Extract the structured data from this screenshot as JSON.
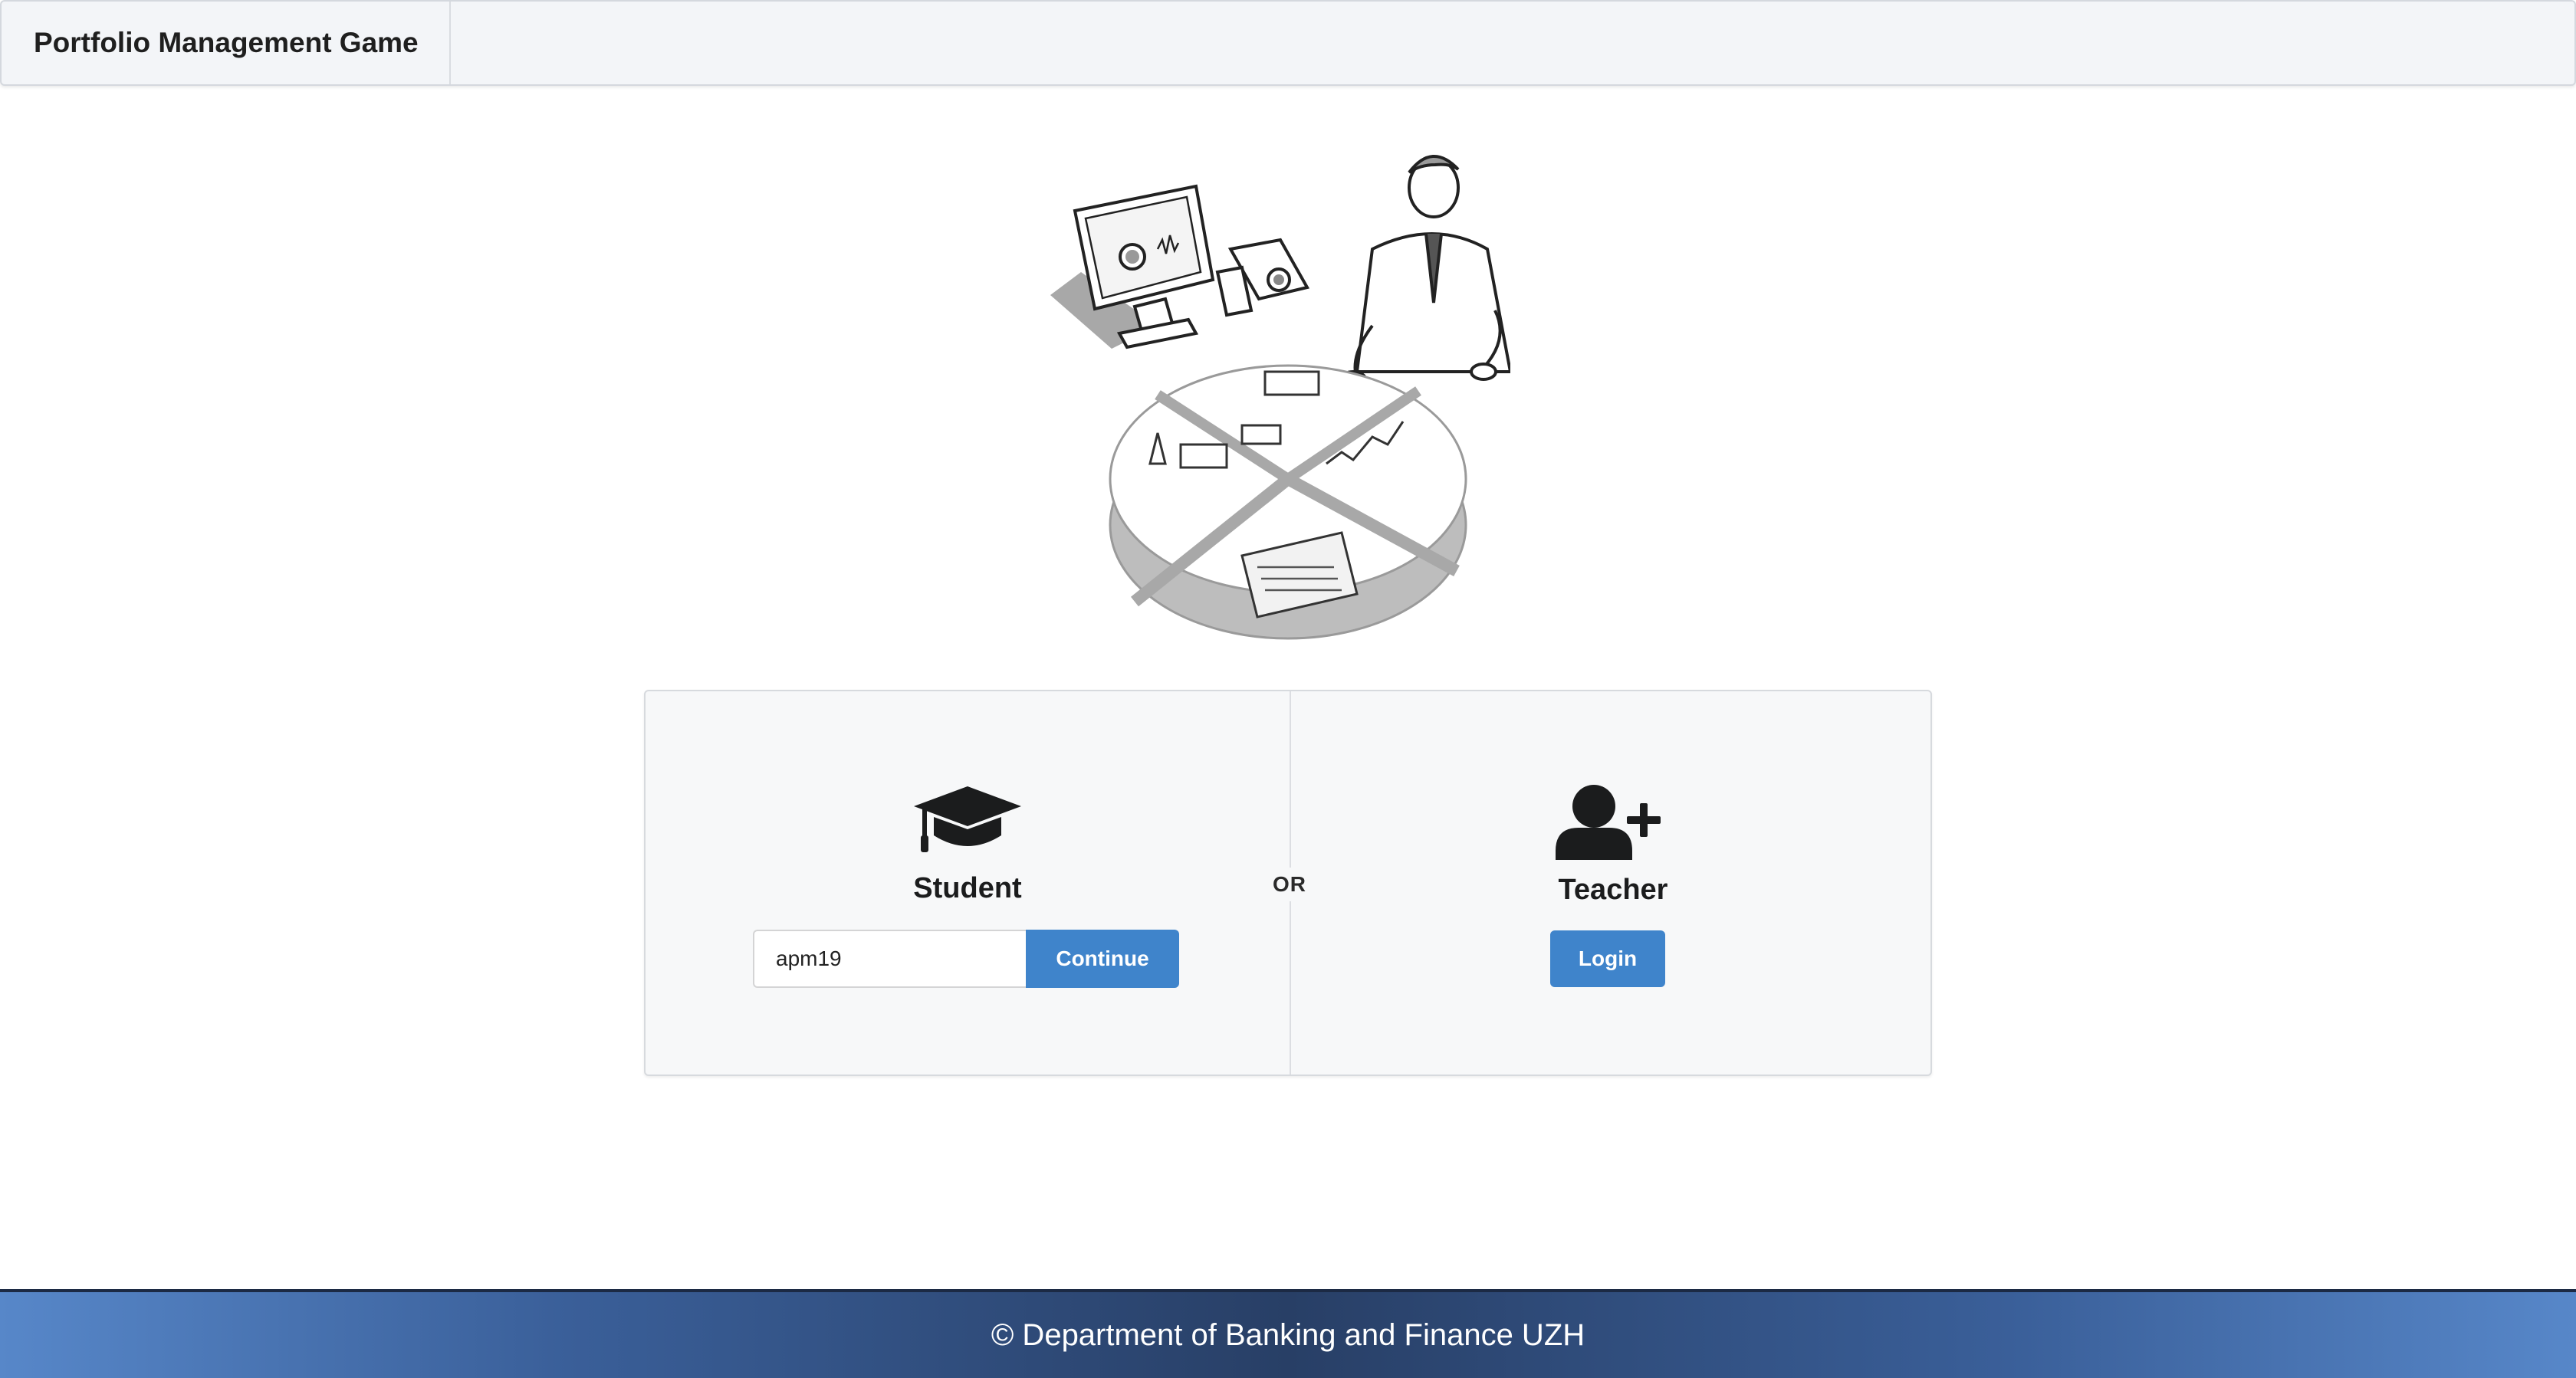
{
  "header": {
    "brand": "Portfolio Management Game"
  },
  "login": {
    "or_label": "OR",
    "student": {
      "icon": "graduation-cap-icon",
      "title": "Student",
      "input_value": "apm19",
      "button_label": "Continue"
    },
    "teacher": {
      "icon": "user-plus-icon",
      "title": "Teacher",
      "button_label": "Login"
    }
  },
  "footer": {
    "text": "© Department of Banking and Finance UZH"
  },
  "colors": {
    "primary_button": "#3f84cb",
    "footer_dark": "#283f66",
    "topbar_bg": "#f3f5f8"
  }
}
